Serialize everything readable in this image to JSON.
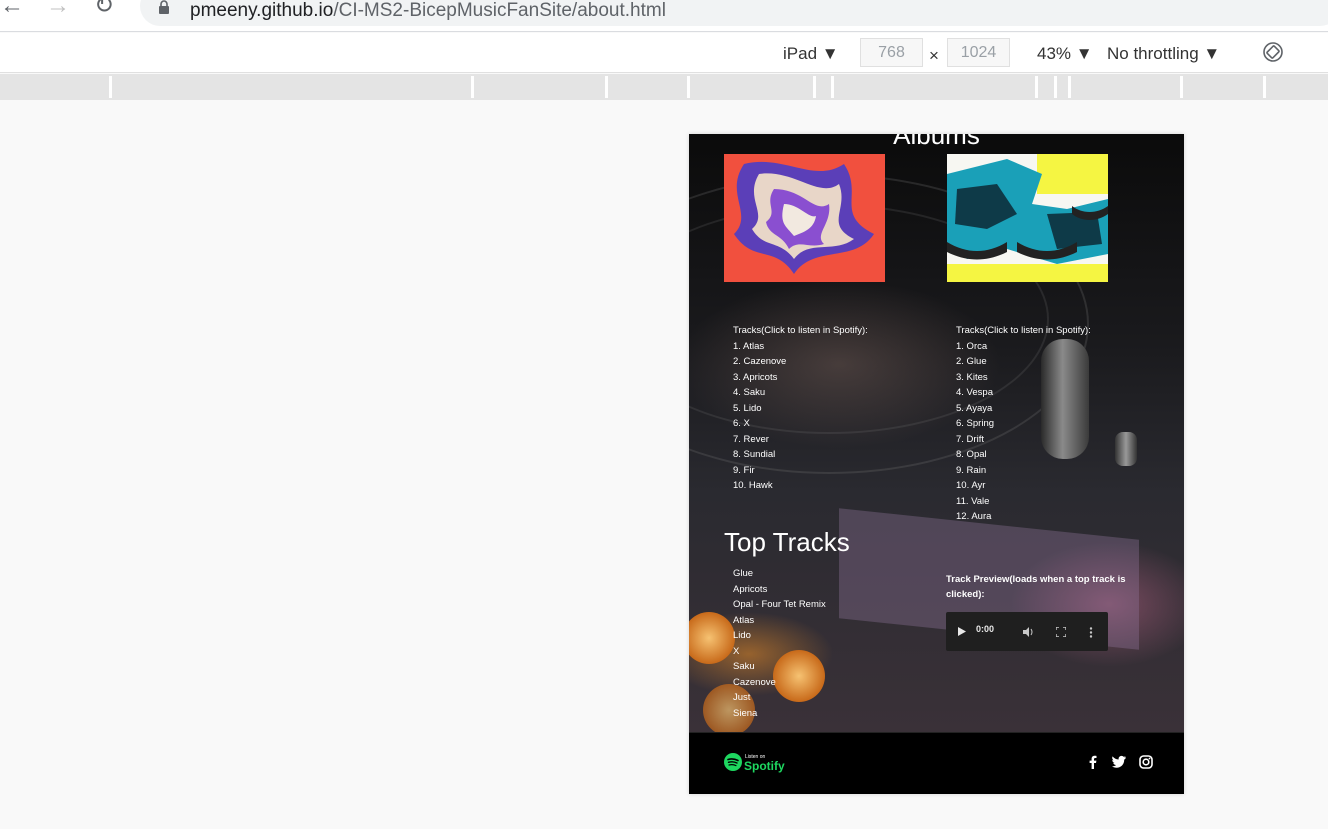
{
  "browser": {
    "url_host": "pmeeny.github.io",
    "url_path": "/CI-MS2-BicepMusicFanSite/about.html"
  },
  "devtools": {
    "device": "iPad",
    "width": "768",
    "times": "×",
    "height": "1024",
    "zoom": "43%",
    "throttling": "No throttling"
  },
  "page": {
    "albums_heading": "Albums",
    "album1_tracks_label": "Tracks(Click to listen in Spotify):",
    "album1_tracks": [
      "1. Atlas",
      "2. Cazenove",
      "3. Apricots",
      "4. Saku",
      "5. Lido",
      "6. X",
      "7. Rever",
      "8. Sundial",
      "9. Fir",
      "10. Hawk"
    ],
    "album2_tracks_label": "Tracks(Click to listen in Spotify):",
    "album2_tracks": [
      "1. Orca",
      "2. Glue",
      "3. Kites",
      "4. Vespa",
      "5. Ayaya",
      "6. Spring",
      "7. Drift",
      "8. Opal",
      "9. Rain",
      "10. Ayr",
      "11. Vale",
      "12. Aura"
    ],
    "top_tracks_heading": "Top Tracks",
    "top_tracks": [
      "Glue",
      "Apricots",
      "Opal - Four Tet Remix",
      "Atlas",
      "Lido",
      "X",
      "Saku",
      "Cazenove",
      "Just",
      "Siena"
    ],
    "preview_label": "Track Preview(loads when a top track is clicked):",
    "player_time": "0:00"
  },
  "footer": {
    "spotify_small": "Listen on",
    "spotify_big": "Spotify"
  },
  "colors": {
    "spotify_green": "#1ed760",
    "album1_bg": "#f1503e",
    "album2_accent": "#f5f542"
  }
}
